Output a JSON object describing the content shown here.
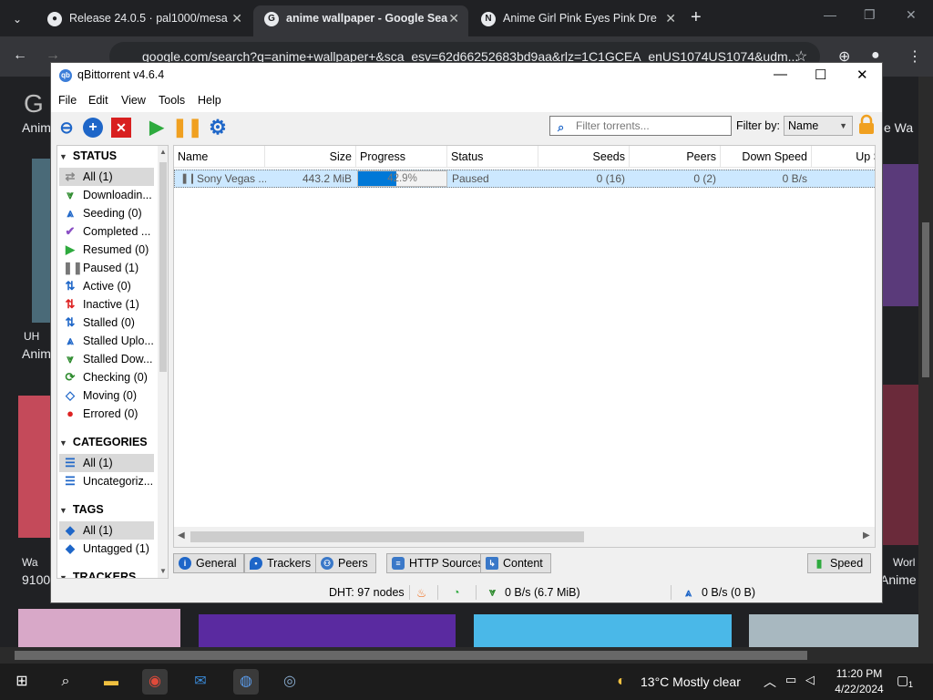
{
  "browser": {
    "tabs": [
      {
        "title": "Release 24.0.5 · pal1000/mesa",
        "icon": "github-icon"
      },
      {
        "title": "anime wallpaper - Google Sea",
        "icon": "google-icon"
      },
      {
        "title": "Anime Girl Pink Eyes Pink Dre",
        "icon": "notion-icon"
      }
    ],
    "url": "google.com/search?q=anime+wallpaper+&sca_esv=62d66252683bd9aa&rlz=1C1GCEA_enUS1074US1074&udm...",
    "page_snippets": {
      "left1": "Anim",
      "left2": "UH",
      "left3": "Anim",
      "left4": "Wa",
      "left5": "9100",
      "right1": "e Wa",
      "right2": "Worl",
      "right3": "Anime"
    }
  },
  "window": {
    "title": "qBittorrent v4.6.4"
  },
  "menu": [
    "File",
    "Edit",
    "View",
    "Tools",
    "Help"
  ],
  "toolbar": {
    "search_placeholder": "Filter torrents...",
    "filter_by_label": "Filter by:",
    "filter_by_value": "Name"
  },
  "sidebar": {
    "status_header": "STATUS",
    "status_items": [
      {
        "label": "All (1)",
        "icon": "all-icon",
        "color": "#888888"
      },
      {
        "label": "Downloadin...",
        "icon": "download-icon",
        "color": "#2e8b2e"
      },
      {
        "label": "Seeding (0)",
        "icon": "upload-icon",
        "color": "#1e66c8"
      },
      {
        "label": "Completed ...",
        "icon": "check-icon",
        "color": "#8a4fc4"
      },
      {
        "label": "Resumed (0)",
        "icon": "play-icon",
        "color": "#2eaa3e"
      },
      {
        "label": "Paused (1)",
        "icon": "pause-icon",
        "color": "#777777"
      },
      {
        "label": "Active (0)",
        "icon": "active-icon",
        "color": "#1e66c8"
      },
      {
        "label": "Inactive (1)",
        "icon": "inactive-icon",
        "color": "#d22"
      },
      {
        "label": "Stalled (0)",
        "icon": "stalled-icon",
        "color": "#1e66c8"
      },
      {
        "label": "Stalled Uplo...",
        "icon": "stalled-upload-icon",
        "color": "#1e66c8"
      },
      {
        "label": "Stalled Dow...",
        "icon": "stalled-download-icon",
        "color": "#2e8b2e"
      },
      {
        "label": "Checking (0)",
        "icon": "checking-icon",
        "color": "#2e8b2e"
      },
      {
        "label": "Moving (0)",
        "icon": "moving-icon",
        "color": "#1e66c8"
      },
      {
        "label": "Errored (0)",
        "icon": "error-icon",
        "color": "#d22"
      }
    ],
    "categories_header": "CATEGORIES",
    "category_items": [
      {
        "label": "All (1)",
        "icon": "list-icon"
      },
      {
        "label": "Uncategoriz...",
        "icon": "list-icon"
      }
    ],
    "tags_header": "TAGS",
    "tag_items": [
      {
        "label": "All (1)",
        "icon": "tag-icon"
      },
      {
        "label": "Untagged (1)",
        "icon": "tag-icon"
      }
    ],
    "trackers_header": "TRACKERS"
  },
  "list": {
    "columns": [
      "Name",
      "Size",
      "Progress",
      "Status",
      "Seeds",
      "Peers",
      "Down Speed",
      "Up S"
    ],
    "rows": [
      {
        "name": "Sony Vegas ...",
        "size": "443.2 MiB",
        "progress": 0.429,
        "progress_text": "42.9%",
        "status": "Paused",
        "seeds": "0 (16)",
        "peers": "0 (2)",
        "down_speed": "0 B/s"
      }
    ]
  },
  "bottom_tabs": [
    "General",
    "Trackers",
    "Peers",
    "HTTP Sources",
    "Content"
  ],
  "speed_tab": "Speed",
  "statusbar": {
    "dht": "DHT: 97 nodes",
    "download": "0 B/s (6.7 MiB)",
    "upload": "0 B/s (0 B)"
  },
  "taskbar": {
    "weather": "13°C  Mostly clear",
    "time": "11:20 PM",
    "date": "4/22/2024",
    "notifications": "1"
  }
}
